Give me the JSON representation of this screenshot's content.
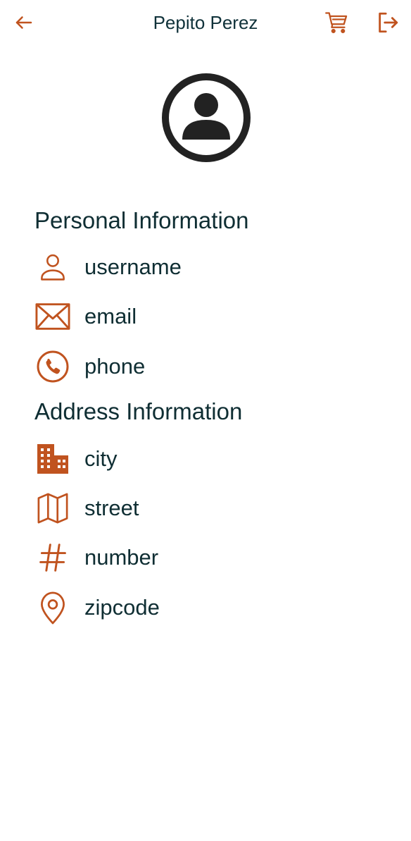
{
  "header": {
    "title": "Pepito Perez",
    "back_icon": "arrow-left-icon",
    "cart_icon": "shopping-cart-icon",
    "logout_icon": "logout-icon"
  },
  "avatar": {
    "icon": "user-circle-icon"
  },
  "personal": {
    "title": "Personal Information",
    "items": [
      {
        "icon": "user-icon",
        "label": "username"
      },
      {
        "icon": "envelope-icon",
        "label": "email"
      },
      {
        "icon": "phone-icon",
        "label": "phone"
      }
    ]
  },
  "address": {
    "title": "Address Information",
    "items": [
      {
        "icon": "building-icon",
        "label": "city"
      },
      {
        "icon": "map-icon",
        "label": "street"
      },
      {
        "icon": "hash-icon",
        "label": "number"
      },
      {
        "icon": "location-pin-icon",
        "label": "zipcode"
      }
    ]
  },
  "colors": {
    "accent": "#c0531f",
    "text": "#0f2e33",
    "avatar": "#222222",
    "background": "#ffffff"
  }
}
